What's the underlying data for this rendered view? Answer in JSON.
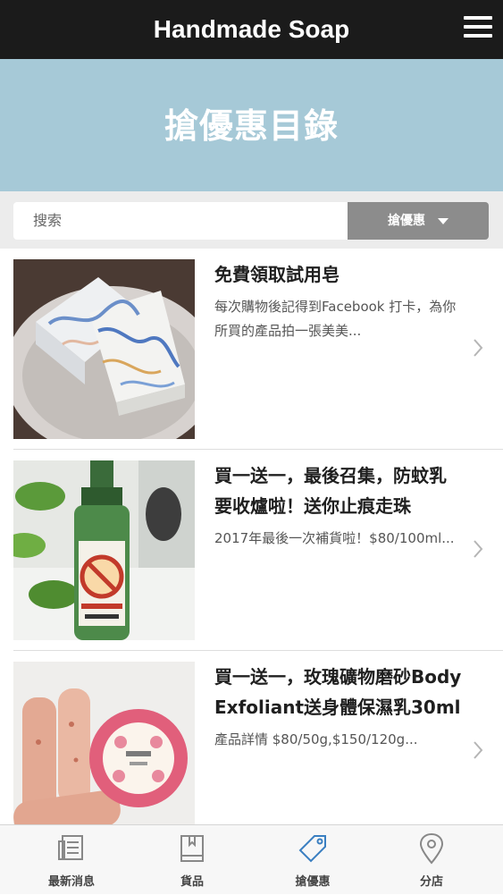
{
  "header": {
    "title": "Handmade Soap"
  },
  "hero": {
    "heading": "搶優惠目錄"
  },
  "search": {
    "placeholder": "搜索",
    "filter_label": "搶優惠"
  },
  "items": [
    {
      "title": "免費領取試用皂",
      "desc": "每次購物後記得到Facebook 打卡，為你所買的產品拍一張美美..."
    },
    {
      "title": "買一送一，最後召集，防蚊乳要收爐啦！送你止痕走珠",
      "desc": "2017年最後一次補貨啦！$80/100ml..."
    },
    {
      "title": "買一送一，玫瑰礦物磨砂Body Exfoliant送身體保濕乳30ml",
      "desc": "產品詳情 $80/50g,$150/120g..."
    }
  ],
  "tabs": [
    {
      "label": "最新消息",
      "icon": "news-icon"
    },
    {
      "label": "貨品",
      "icon": "book-icon"
    },
    {
      "label": "搶優惠",
      "icon": "tag-icon"
    },
    {
      "label": "分店",
      "icon": "location-pin-icon"
    }
  ],
  "colors": {
    "accent": "#3a7fc1",
    "hero": "#a6c9d7",
    "topbar": "#1b1b1b"
  }
}
